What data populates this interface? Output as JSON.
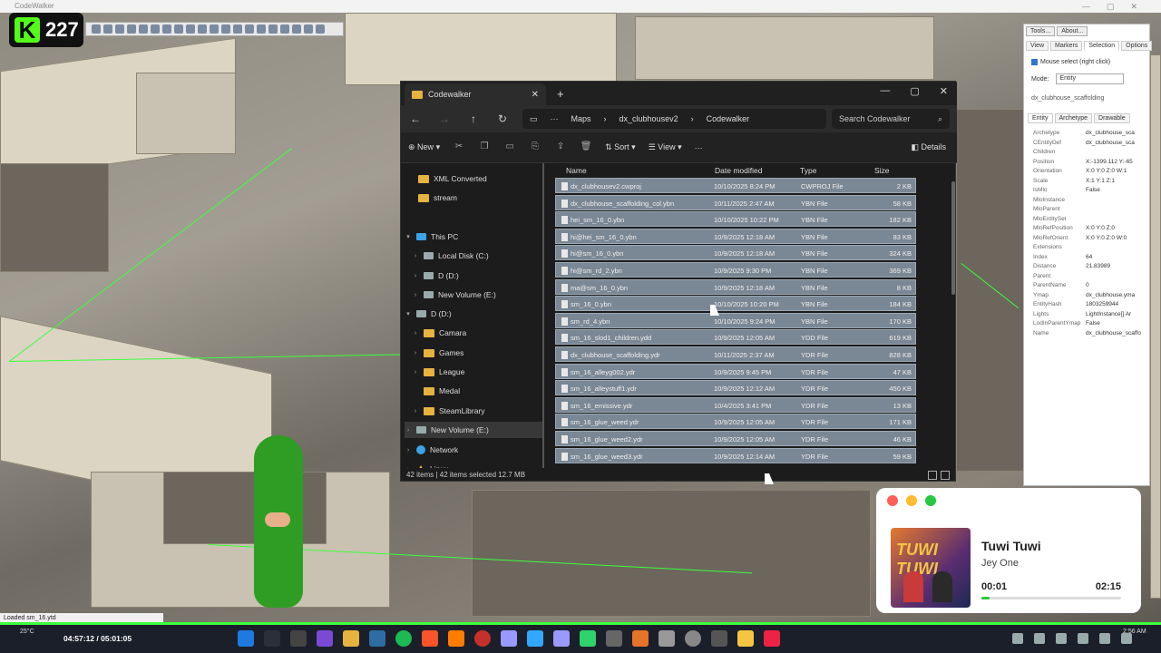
{
  "window_title": "CodeWalker",
  "kick_count": "227",
  "explorer": {
    "tab_title": "Codewalker",
    "breadcrumb": [
      "Maps",
      "dx_clubhousev2",
      "Codewalker"
    ],
    "search_placeholder": "Search Codewalker",
    "cmd": {
      "new": "New",
      "sort": "Sort",
      "view": "View",
      "details": "Details"
    },
    "headers": {
      "name": "Name",
      "date": "Date modified",
      "type": "Type",
      "size": "Size"
    },
    "sidebar": [
      {
        "label": "XML Converted",
        "icon": "folder-icon"
      },
      {
        "label": "stream",
        "icon": "folder-icon"
      },
      {
        "label": "This PC",
        "icon": "pc-icon"
      },
      {
        "label": "Local Disk (C:)",
        "icon": "drive-icon"
      },
      {
        "label": "D (D:)",
        "icon": "drive-icon"
      },
      {
        "label": "New Volume (E:)",
        "icon": "drive-icon"
      },
      {
        "label": "D (D:)",
        "icon": "drive-icon"
      },
      {
        "label": "Camara",
        "icon": "folder-icon"
      },
      {
        "label": "Games",
        "icon": "folder-icon"
      },
      {
        "label": "League",
        "icon": "folder-icon"
      },
      {
        "label": "Medal",
        "icon": "folder-icon"
      },
      {
        "label": "SteamLibrary",
        "icon": "folder-icon"
      },
      {
        "label": "New Volume (E:)",
        "icon": "drive-icon"
      },
      {
        "label": "Network",
        "icon": "network-icon"
      },
      {
        "label": "Linux",
        "icon": "linux-icon"
      }
    ],
    "files": [
      {
        "name": "dx_clubhousev2.cwproj",
        "date": "10/10/2025 8:24 PM",
        "type": "CWPROJ File",
        "size": "2 KB"
      },
      {
        "name": "dx_clubhouse_scaffolding_col.ybn",
        "date": "10/11/2025 2:47 AM",
        "type": "YBN File",
        "size": "58 KB"
      },
      {
        "name": "hei_sm_16_0.ybn",
        "date": "10/10/2025 10:22 PM",
        "type": "YBN File",
        "size": "182 KB"
      },
      {
        "name": "hi@hei_sm_16_0.ybn",
        "date": "10/9/2025 12:18 AM",
        "type": "YBN File",
        "size": "83 KB"
      },
      {
        "name": "hi@sm_16_0.ybn",
        "date": "10/9/2025 12:18 AM",
        "type": "YBN File",
        "size": "324 KB"
      },
      {
        "name": "hi@sm_rd_2.ybn",
        "date": "10/9/2025 9:30 PM",
        "type": "YBN File",
        "size": "369 KB"
      },
      {
        "name": "ma@sm_16_0.ybn",
        "date": "10/9/2025 12:18 AM",
        "type": "YBN File",
        "size": "8 KB"
      },
      {
        "name": "sm_16_0.ybn",
        "date": "10/10/2025 10:20 PM",
        "type": "YBN File",
        "size": "184 KB"
      },
      {
        "name": "sm_rd_4.ybn",
        "date": "10/10/2025 9:24 PM",
        "type": "YBN File",
        "size": "170 KB"
      },
      {
        "name": "sm_16_slod1_children.ydd",
        "date": "10/9/2025 12:05 AM",
        "type": "YDD File",
        "size": "619 KB"
      },
      {
        "name": "dx_clubhouse_scaffolding.ydr",
        "date": "10/11/2025 2:37 AM",
        "type": "YDR File",
        "size": "828 KB"
      },
      {
        "name": "sm_16_alleyg002.ydr",
        "date": "10/9/2025 9:45 PM",
        "type": "YDR File",
        "size": "47 KB"
      },
      {
        "name": "sm_16_alleystuff1.ydr",
        "date": "10/9/2025 12:12 AM",
        "type": "YDR File",
        "size": "450 KB"
      },
      {
        "name": "sm_16_emissive.ydr",
        "date": "10/4/2025 3:41 PM",
        "type": "YDR File",
        "size": "13 KB"
      },
      {
        "name": "sm_16_glue_weed.ydr",
        "date": "10/9/2025 12:05 AM",
        "type": "YDR File",
        "size": "171 KB"
      },
      {
        "name": "sm_16_glue_weed2.ydr",
        "date": "10/9/2025 12:05 AM",
        "type": "YDR File",
        "size": "46 KB"
      },
      {
        "name": "sm_16_glue_weed3.ydr",
        "date": "10/9/2025 12:14 AM",
        "type": "YDR File",
        "size": "59 KB"
      }
    ],
    "status": "42 items  |  42 items selected  12.7 MB"
  },
  "rpanel": {
    "top_buttons": [
      "Tools...",
      "About..."
    ],
    "tabs": [
      "View",
      "Markers",
      "Selection",
      "Options"
    ],
    "mouse_select": "Mouse select (right click)",
    "mode_label": "Mode:",
    "mode_value": "Entity",
    "selected_name": "dx_clubhouse_scaffolding",
    "subtabs": [
      "Entity",
      "Archetype",
      "Drawable"
    ],
    "props": [
      {
        "k": "Archetype",
        "v": "dx_clubhouse_sca"
      },
      {
        "k": "CEntityDef",
        "v": "dx_clubhouse_sca"
      },
      {
        "k": "Children",
        "v": ""
      },
      {
        "k": "Position",
        "v": "X:-1399.112 Y:-65"
      },
      {
        "k": "Orientation",
        "v": "X:0 Y:0 Z:0 W:1"
      },
      {
        "k": "Scale",
        "v": "X:1 Y:1 Z:1"
      },
      {
        "k": "IsMlo",
        "v": "False"
      },
      {
        "k": "MloInstance",
        "v": ""
      },
      {
        "k": "MloParent",
        "v": ""
      },
      {
        "k": "MloEntitySet",
        "v": ""
      },
      {
        "k": "MloRefPosition",
        "v": "X:0 Y:0 Z:0"
      },
      {
        "k": "MloRefOrient",
        "v": "X:0 Y:0 Z:0 W:0"
      },
      {
        "k": "Extensions",
        "v": ""
      },
      {
        "k": "Index",
        "v": "64"
      },
      {
        "k": "Distance",
        "v": "21.83989"
      },
      {
        "k": "Parent",
        "v": ""
      },
      {
        "k": "ParentName",
        "v": "0"
      },
      {
        "k": "Ymap",
        "v": "dx_clubhouse.yma"
      },
      {
        "k": "EntityHash",
        "v": "1803259944"
      },
      {
        "k": "Lights",
        "v": "LightInstance[] Ar"
      },
      {
        "k": "LodInParentYmap",
        "v": "False"
      },
      {
        "k": "Name",
        "v": "dx_clubhouse_scaffo"
      }
    ]
  },
  "music": {
    "title": "Tuwi Tuwi",
    "artist": "Jey One",
    "elapsed": "00:01",
    "total": "02:15",
    "cover_text": "TUWI TUWI",
    "progress": 0.01
  },
  "status_bar": "Loaded sm_16.ytd",
  "taskbar": {
    "weather": "25°C",
    "timer": "04:57:12 / 05:01:05",
    "clock": "2:56 AM"
  }
}
